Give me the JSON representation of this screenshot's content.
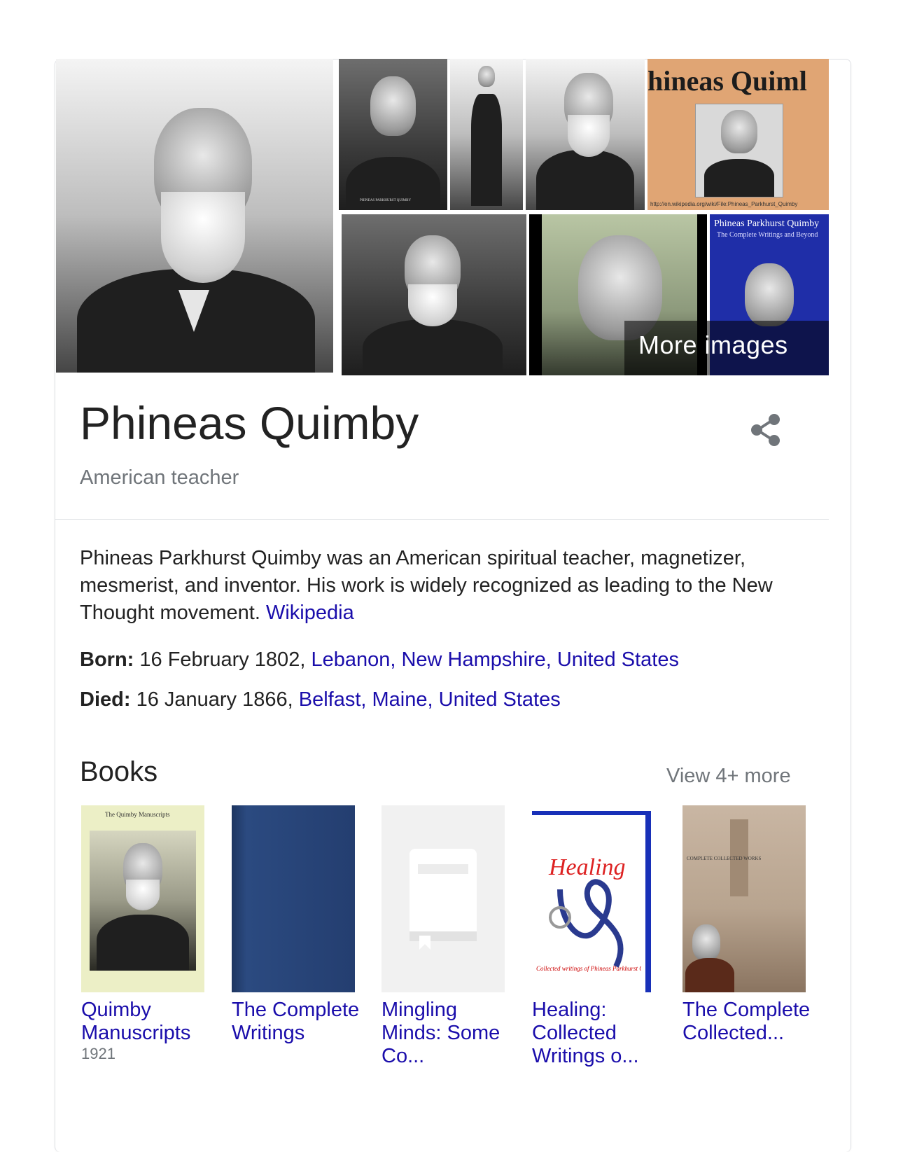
{
  "gallery": {
    "more_images_label": "More images",
    "orange_cover_title": "hineas Quiml",
    "orange_cover_url": "http://en.wikipedia.org/wiki/File:Phineas_Parkhurst_Quimby",
    "blue_cover_title": "Phineas Parkhurst Quimby",
    "blue_cover_subtitle": "The Complete Writings and Beyond",
    "portrait_caption": "PHINEAS PARKHURST QUIMBY"
  },
  "entity": {
    "name": "Phineas Quimby",
    "subtitle": "American teacher"
  },
  "description": {
    "text": "Phineas Parkhurst Quimby was an American spiritual teacher, magnetizer, mesmerist, and inventor. His work is widely recognized as leading to the New Thought movement.",
    "source_link": "Wikipedia"
  },
  "facts": {
    "born_label": "Born:",
    "born_value": "16 February 1802,",
    "born_place": "Lebanon, New Hampshire, United States",
    "died_label": "Died:",
    "died_value": "16 January 1866,",
    "died_place": "Belfast, Maine, United States"
  },
  "books": {
    "heading": "Books",
    "view_more": "View 4+ more",
    "items": [
      {
        "title": "Quimby Manuscripts",
        "year": "1921",
        "cover_text": "The Quimby Manuscripts"
      },
      {
        "title": "The Complete Writings",
        "year": ""
      },
      {
        "title": "Mingling Minds: Some Co...",
        "year": ""
      },
      {
        "title": "Healing: Collected Writings o...",
        "year": "",
        "cover_text": "Healing",
        "cover_sub": "Collected writings of Phineas Parkhurst Quimby"
      },
      {
        "title": "The Complete Collected...",
        "year": "",
        "cover_text": "COMPLETE COLLECTED WORKS"
      }
    ]
  },
  "colors": {
    "link": "#1a0dab",
    "secondary_text": "#70757a",
    "border": "#dfe1e5"
  }
}
